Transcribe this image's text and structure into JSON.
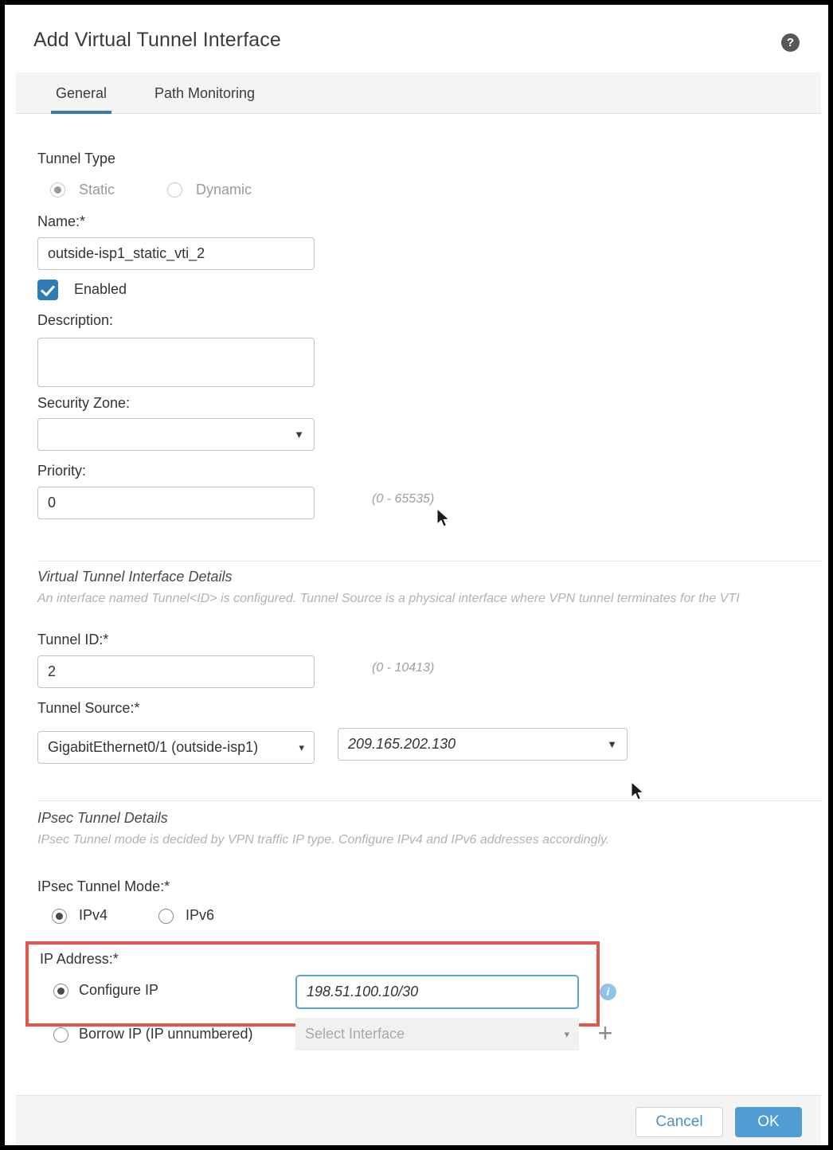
{
  "dialog": {
    "title": "Add Virtual Tunnel Interface",
    "help_icon_label": "?"
  },
  "tabs": [
    {
      "label": "General",
      "active": true
    },
    {
      "label": "Path Monitoring",
      "active": false
    }
  ],
  "general": {
    "tunnel_type": {
      "label": "Tunnel Type",
      "options": [
        {
          "label": "Static",
          "selected": true,
          "disabled": true
        },
        {
          "label": "Dynamic",
          "selected": false,
          "disabled": true
        }
      ]
    },
    "name": {
      "label": "Name:*",
      "value": "outside-isp1_static_vti_2",
      "placeholder": ""
    },
    "enabled": {
      "label": "Enabled",
      "checked": true
    },
    "description": {
      "label": "Description:",
      "value": "",
      "placeholder": ""
    },
    "security_zone": {
      "label": "Security Zone:",
      "value": "",
      "caret": "▼"
    },
    "priority": {
      "label": "Priority:",
      "value": "0",
      "range_hint": "(0 - 65535)"
    }
  },
  "vti_details": {
    "section_title": "Virtual Tunnel Interface Details",
    "section_desc": "An interface named Tunnel<ID> is configured. Tunnel Source is a physical interface where VPN tunnel terminates for the VTI",
    "tunnel_id": {
      "label": "Tunnel ID:*",
      "value": "2",
      "range_hint": "(0 - 10413)"
    },
    "tunnel_source": {
      "label": "Tunnel Source:*",
      "interface_value": "GigabitEthernet0/1 (outside-isp1)",
      "interface_caret": "▾",
      "ip_value": "209.165.202.130",
      "ip_caret": "▼"
    }
  },
  "ipsec_details": {
    "section_title": "IPsec Tunnel Details",
    "section_desc": "IPsec Tunnel mode is decided by VPN traffic IP type. Configure IPv4 and IPv6 addresses accordingly.",
    "tunnel_mode": {
      "label": "IPsec Tunnel Mode:*",
      "options": [
        {
          "label": "IPv4",
          "selected": true
        },
        {
          "label": "IPv6",
          "selected": false
        }
      ]
    },
    "ip_address": {
      "label": "IP Address:*",
      "highlighted": true,
      "highlight_color": "#e2574c",
      "configure_ip": {
        "label": "Configure IP",
        "selected": true,
        "value": "198.51.100.10/30",
        "placeholder": "",
        "info_icon_label": "i"
      },
      "borrow_ip": {
        "label": "Borrow IP (IP unnumbered)",
        "selected": false,
        "select_placeholder": "Select Interface",
        "caret": "▾",
        "add_label": "+"
      }
    }
  },
  "footer": {
    "cancel_label": "Cancel",
    "ok_label": "OK"
  },
  "colors": {
    "accent_blue": "#337ab7",
    "primary_button": "#4f9dd4",
    "checkbox_blue": "#2d7cb5",
    "highlight_red": "#e2574c",
    "info_blue": "#8fc3e8"
  }
}
